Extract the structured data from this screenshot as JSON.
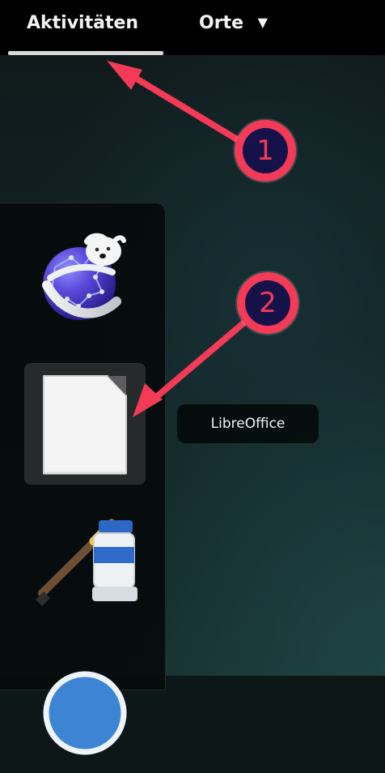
{
  "topbar": {
    "activities_label": "Aktivitäten",
    "places_label": "Orte",
    "places_caret": "▼"
  },
  "tooltip": {
    "label": "LibreOffice"
  },
  "annotations": [
    {
      "number": "1"
    },
    {
      "number": "2"
    }
  ],
  "colors": {
    "accent": "#f33a56",
    "annotation_fill": "#15124a",
    "topbar": "#000000"
  },
  "icons": [
    "kde-globe-icon",
    "libreoffice-icon",
    "paint-brush-icon"
  ]
}
